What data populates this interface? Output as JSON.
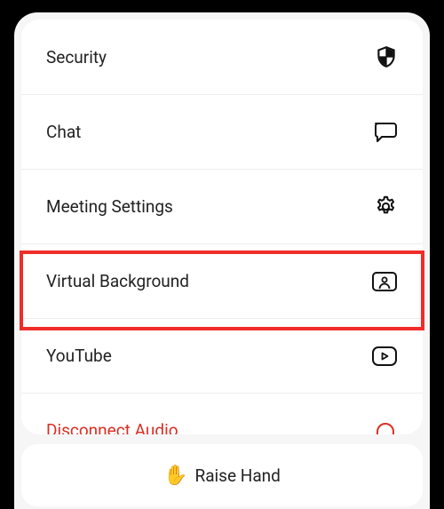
{
  "menu": {
    "items": [
      {
        "label": "Security",
        "icon": "shield-icon",
        "danger": false
      },
      {
        "label": "Chat",
        "icon": "chat-icon",
        "danger": false
      },
      {
        "label": "Meeting Settings",
        "icon": "gear-icon",
        "danger": false
      },
      {
        "label": "Virtual Background",
        "icon": "person-frame-icon",
        "danger": false
      },
      {
        "label": "YouTube",
        "icon": "play-rect-icon",
        "danger": false
      },
      {
        "label": "Disconnect Audio",
        "icon": "headphone-off-icon",
        "danger": true
      }
    ]
  },
  "raise_hand": {
    "emoji": "✋",
    "label": "Raise Hand"
  },
  "highlight_index": 3
}
